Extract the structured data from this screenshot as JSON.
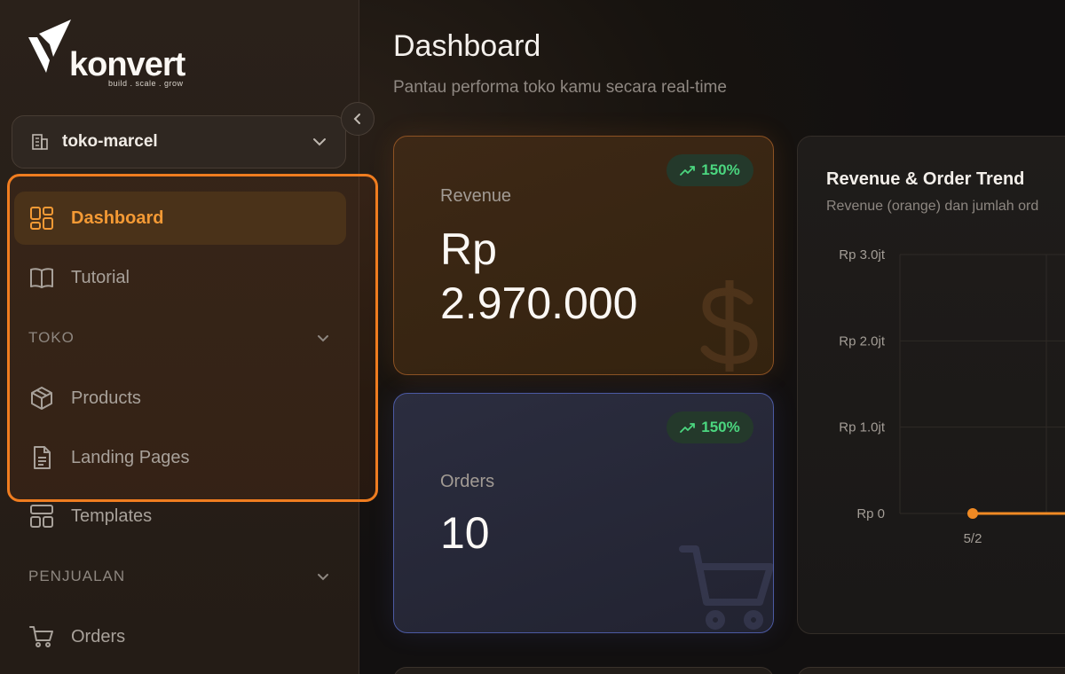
{
  "brand": {
    "name": "konvert",
    "tagline": "build . scale . grow"
  },
  "store_selector": {
    "value": "toko-marcel",
    "icon": "building-icon"
  },
  "nav": {
    "dashboard": {
      "label": "Dashboard",
      "icon": "grid-icon",
      "active": true
    },
    "tutorial": {
      "label": "Tutorial",
      "icon": "book-icon"
    },
    "section_toko": "TOKO",
    "products": {
      "label": "Products",
      "icon": "box-icon"
    },
    "landing_pages": {
      "label": "Landing Pages",
      "icon": "document-icon"
    },
    "templates": {
      "label": "Templates",
      "icon": "layout-icon"
    },
    "section_penjualan": "PENJUALAN",
    "orders": {
      "label": "Orders",
      "icon": "cart-icon"
    }
  },
  "header": {
    "title": "Dashboard",
    "subtitle": "Pantau performa toko kamu secara real-time"
  },
  "cards": {
    "revenue": {
      "label": "Revenue",
      "value_line1": "Rp",
      "value_line2": "2.970.000",
      "change": "150%"
    },
    "orders": {
      "label": "Orders",
      "value": "10",
      "change": "150%"
    }
  },
  "chart": {
    "title": "Revenue & Order Trend",
    "subtitle": "Revenue (orange) dan jumlah ord"
  },
  "chart_data": {
    "type": "line",
    "title": "Revenue & Order Trend",
    "subtitle": "Revenue (orange) dan jumlah ord",
    "y_ticks": [
      "Rp 3.0jt",
      "Rp 2.0jt",
      "Rp 1.0jt",
      "Rp 0"
    ],
    "ylim": [
      0,
      3000000
    ],
    "categories": [
      "5/2"
    ],
    "series": [
      {
        "values": [
          0
        ],
        "color": "#f08a24"
      }
    ],
    "grid": true
  },
  "colors": {
    "accent": "#f08a24",
    "success": "#4bd67f",
    "orders_border": "#4c5aa3"
  }
}
